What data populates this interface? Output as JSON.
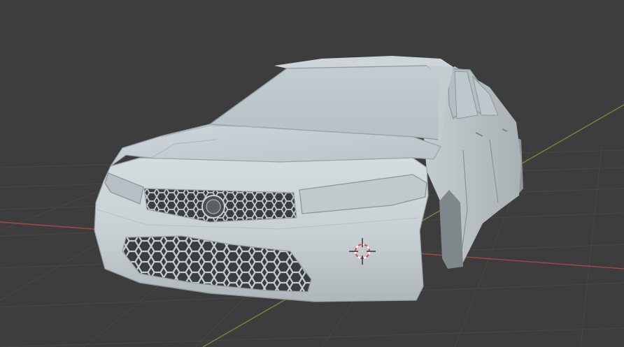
{
  "viewport": {
    "background_color": "#3d3d3d",
    "grid_line_color": "#4a4a4a",
    "x_axis_color": "#a8464c",
    "y_axis_color": "#6f8a3a"
  },
  "scene_object": {
    "kind": "car-body-mesh",
    "shade_color": "#c8d0d4",
    "grille_pattern": "hexagonal"
  },
  "cursor_3d": {
    "icon": "3d-cursor-icon",
    "ring_colors": [
      "#e05050",
      "#ffffff"
    ]
  }
}
